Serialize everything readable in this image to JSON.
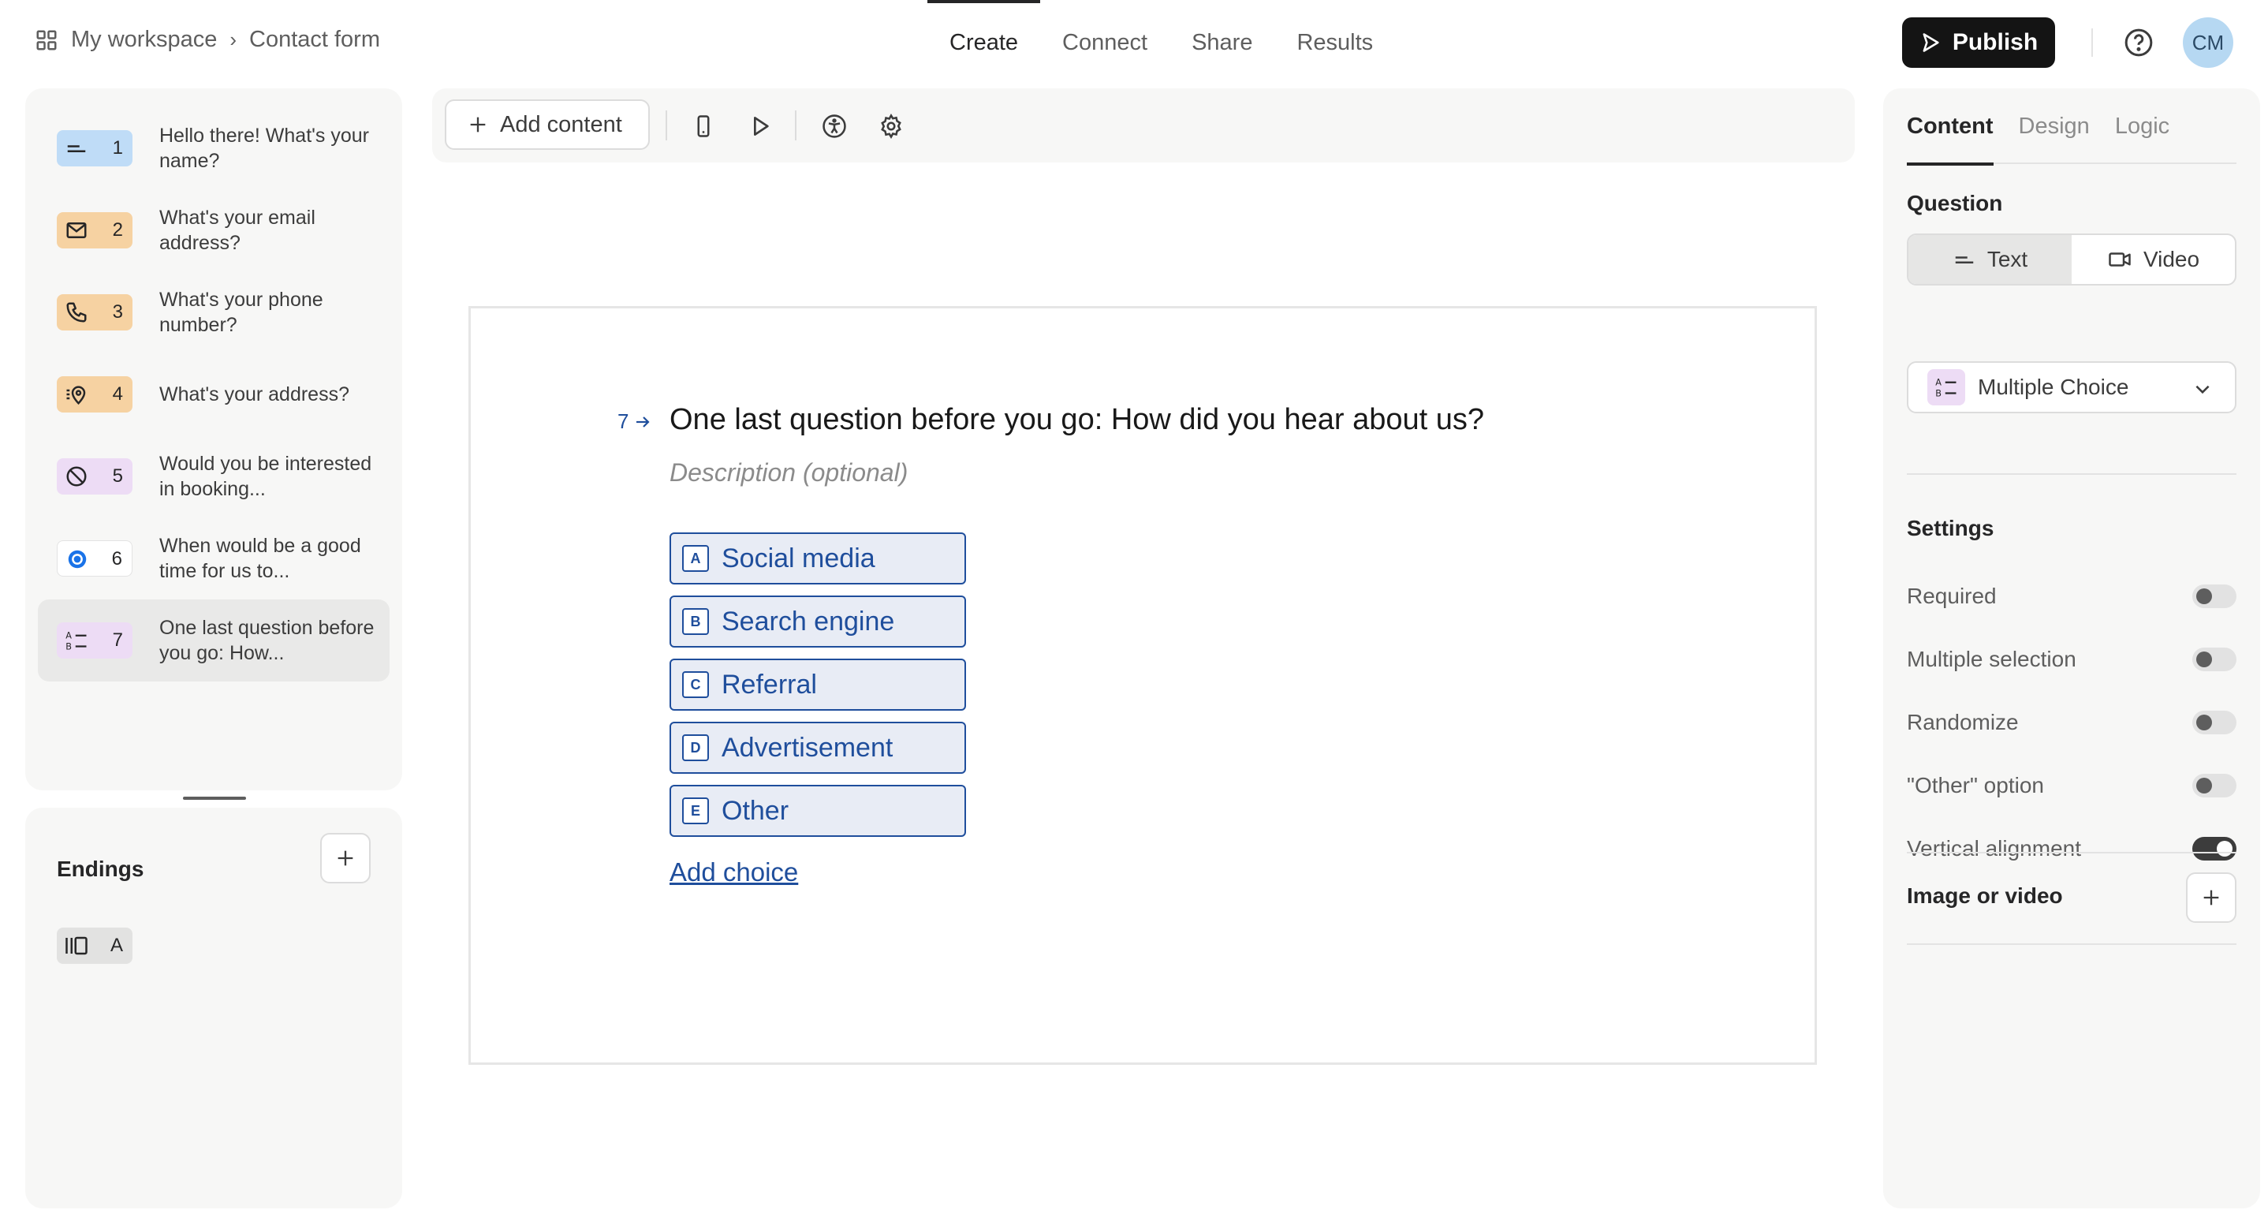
{
  "breadcrumb": {
    "workspace": "My workspace",
    "separator": "›",
    "form": "Contact form"
  },
  "nav": {
    "tabs": [
      "Create",
      "Connect",
      "Share",
      "Results"
    ],
    "active": "Create"
  },
  "header": {
    "publish_label": "Publish",
    "avatar_initials": "CM"
  },
  "questions": [
    {
      "number": "1",
      "text": "Hello there! What's your name?",
      "icon": "short-text-icon",
      "color": "#bfdcf7"
    },
    {
      "number": "2",
      "text": "What's your email address?",
      "icon": "mail-icon",
      "color": "#f6d2a2"
    },
    {
      "number": "3",
      "text": "What's your phone number?",
      "icon": "phone-icon",
      "color": "#f6d2a2"
    },
    {
      "number": "4",
      "text": "What's your address?",
      "icon": "location-pin-icon",
      "color": "#f6d2a2"
    },
    {
      "number": "5",
      "text": "Would you be interested in booking...",
      "icon": "prohibited-icon",
      "color": "#eddcf5"
    },
    {
      "number": "6",
      "text": "When would be a good time for us to...",
      "icon": "calendly-icon",
      "color": "#ffffff"
    },
    {
      "number": "7",
      "text": "One last question before you go: How...",
      "icon": "multiple-choice-icon",
      "color": "#eddcf5",
      "active": true
    }
  ],
  "endings": {
    "title": "Endings",
    "items": [
      {
        "label": "A",
        "icon": "ending-screen-icon"
      }
    ]
  },
  "toolbar": {
    "add_content_label": "Add content"
  },
  "canvas": {
    "question_number": "7",
    "question_title": "One last question before you go: How did you hear about us?",
    "description_placeholder": "Description (optional)",
    "choices": [
      {
        "key": "A",
        "label": "Social media"
      },
      {
        "key": "B",
        "label": "Search engine"
      },
      {
        "key": "C",
        "label": "Referral"
      },
      {
        "key": "D",
        "label": "Advertisement"
      },
      {
        "key": "E",
        "label": "Other"
      }
    ],
    "add_choice_label": "Add choice"
  },
  "right_panel": {
    "tabs": [
      "Content",
      "Design",
      "Logic"
    ],
    "active_tab": "Content",
    "question_label": "Question",
    "question_modes": [
      "Text",
      "Video"
    ],
    "active_mode": "Text",
    "question_type": "Multiple Choice",
    "settings_label": "Settings",
    "settings": [
      {
        "label": "Required",
        "on": false
      },
      {
        "label": "Multiple selection",
        "on": false
      },
      {
        "label": "Randomize",
        "on": false
      },
      {
        "label": "\"Other\" option",
        "on": false
      },
      {
        "label": "Vertical alignment",
        "on": true
      }
    ],
    "media_label": "Image or video"
  },
  "colors": {
    "accent_blue": "#1f4e9c",
    "publish_bg": "#141414",
    "panel_bg": "#f7f7f6"
  }
}
